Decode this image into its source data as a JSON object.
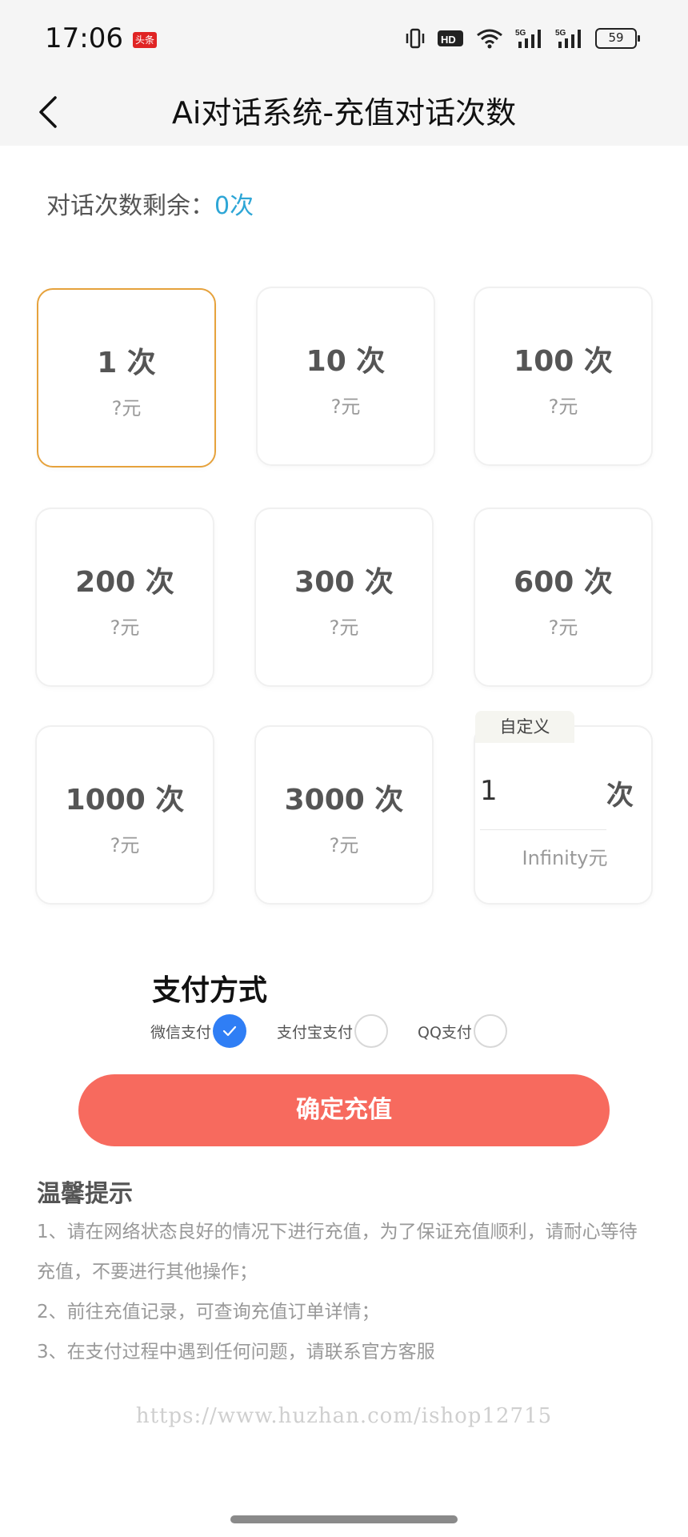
{
  "status_bar": {
    "time": "17:06",
    "badge": "头条",
    "battery": "59"
  },
  "header": {
    "title": "Ai对话系统-充值对话次数"
  },
  "remaining": {
    "label": "对话次数剩余：",
    "value": "0次"
  },
  "packages": [
    {
      "count": "1 次",
      "price": "?元",
      "selected": true
    },
    {
      "count": "10 次",
      "price": "?元"
    },
    {
      "count": "100 次",
      "price": "?元"
    },
    {
      "count": "200 次",
      "price": "?元"
    },
    {
      "count": "300 次",
      "price": "?元"
    },
    {
      "count": "600 次",
      "price": "?元"
    },
    {
      "count": "1000 次",
      "price": "?元"
    },
    {
      "count": "3000 次",
      "price": "?元"
    }
  ],
  "custom": {
    "tag": "自定义",
    "value": "1",
    "unit": "次",
    "price": "Infinity元"
  },
  "payment": {
    "title": "支付方式",
    "options": [
      {
        "label": "微信支付",
        "checked": true
      },
      {
        "label": "支付宝支付",
        "checked": false
      },
      {
        "label": "QQ支付",
        "checked": false
      }
    ]
  },
  "submit_label": "确定充值",
  "tips": {
    "title": "温馨提示",
    "items": [
      "1、请在网络状态良好的情况下进行充值，为了保证充值顺利，请耐心等待充值，不要进行其他操作；",
      "2、前往充值记录，可查询充值订单详情；",
      "3、在支付过程中遇到任何问题，请联系官方客服"
    ]
  },
  "watermark": "https://www.huzhan.com/ishop12715",
  "colors": {
    "accent_blue": "#2ea6d6",
    "selected_border": "#e6a23c",
    "submit_bg": "#f76a5e",
    "radio_checked": "#2f7ef5"
  }
}
